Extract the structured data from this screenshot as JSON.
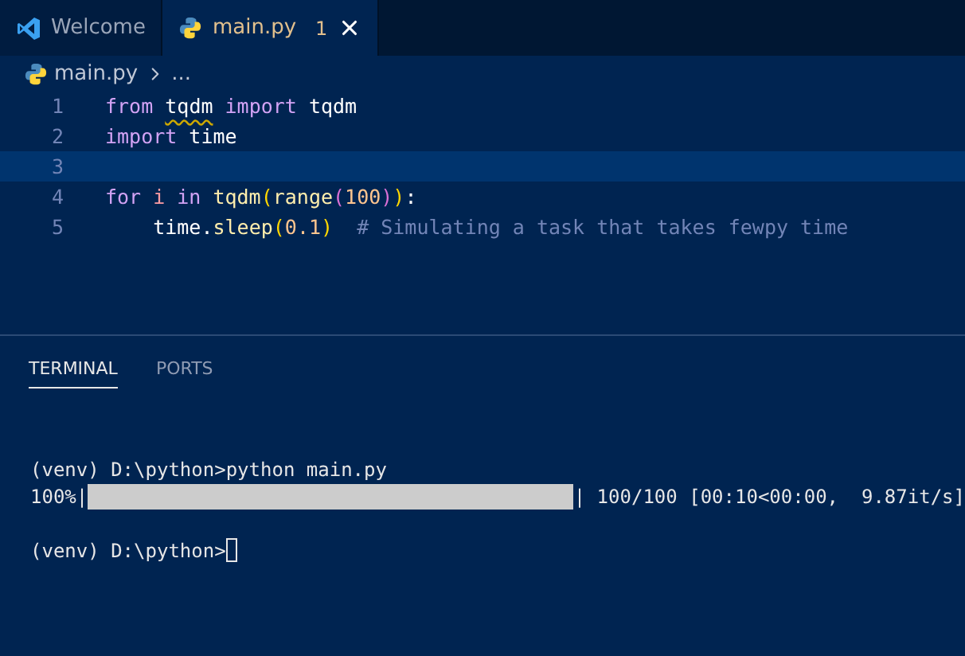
{
  "tabs": [
    {
      "label": "Welcome",
      "selected": false
    },
    {
      "label": "main.py",
      "selected": true,
      "problems": "1"
    }
  ],
  "breadcrumb": {
    "file": "main.py",
    "rest": "..."
  },
  "code_lines": [
    {
      "number": "1",
      "current": false,
      "tokens": [
        {
          "text": "from ",
          "kind": "keyword"
        },
        {
          "text": "tqdm",
          "kind": "module",
          "squiggle": true
        },
        {
          "text": " import",
          "kind": "keyword"
        },
        {
          "text": " tqdm",
          "kind": "module"
        }
      ]
    },
    {
      "number": "2",
      "current": false,
      "tokens": [
        {
          "text": "import",
          "kind": "keyword"
        },
        {
          "text": " time",
          "kind": "module"
        }
      ]
    },
    {
      "number": "3",
      "current": true
    },
    {
      "number": "4",
      "current": false,
      "tokens": [
        {
          "text": "for",
          "kind": "keyword"
        },
        {
          "text": " i ",
          "kind": "variable"
        },
        {
          "text": "in ",
          "kind": "keyword"
        },
        {
          "text": "tqdm",
          "kind": "function"
        },
        {
          "text": "(",
          "kind": "paren1"
        },
        {
          "text": "range",
          "kind": "function"
        },
        {
          "text": "(",
          "kind": "paren2"
        },
        {
          "text": "100",
          "kind": "number"
        },
        {
          "text": ")",
          "kind": "paren2"
        },
        {
          "text": ")",
          "kind": "paren1"
        },
        {
          "text": ":",
          "kind": "plain"
        }
      ]
    },
    {
      "number": "5",
      "current": false,
      "tokens": [
        {
          "text": "    time",
          "kind": "module"
        },
        {
          "text": ".",
          "kind": "plain"
        },
        {
          "text": "sleep",
          "kind": "function"
        },
        {
          "text": "(",
          "kind": "paren1"
        },
        {
          "text": "0.1",
          "kind": "number"
        },
        {
          "text": ")",
          "kind": "paren1"
        },
        {
          "text": "  # Simulating a task that takes fewpy time",
          "kind": "comment"
        }
      ]
    }
  ],
  "panel_tabs": [
    {
      "label": "TERMINAL",
      "selected": true
    },
    {
      "label": "PORTS",
      "selected": false
    }
  ],
  "terminal_lines": [
    {
      "kind": "text",
      "text": "(venv) D:\\python>python main.py"
    },
    {
      "kind": "progress",
      "prefix": "100%|",
      "level": 1,
      "suffix": "| 100/100 [00:10<00:00,  9.87it/s]"
    },
    {
      "kind": "prompt",
      "text": "(venv) D:\\python>",
      "cursor": true
    }
  ]
}
